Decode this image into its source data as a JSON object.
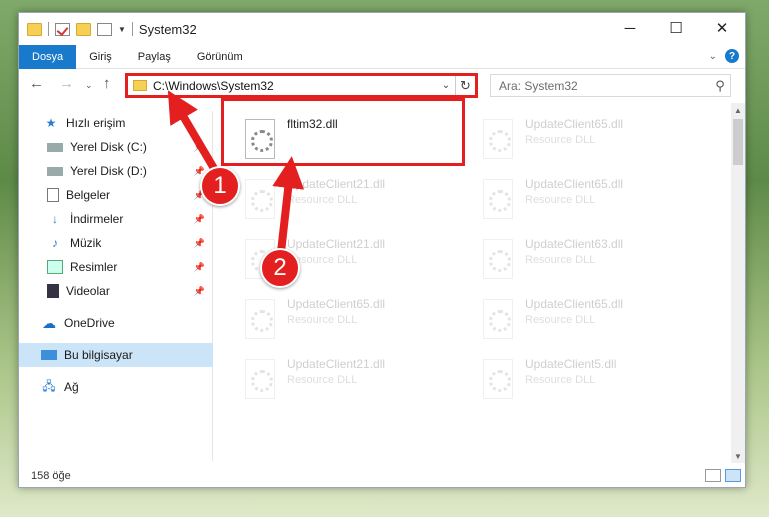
{
  "window": {
    "title": "System32",
    "controls": {
      "minimize": "─",
      "maximize": "☐",
      "close": "✕"
    }
  },
  "ribbon": {
    "tabs": [
      {
        "label": "Dosya",
        "active": true
      },
      {
        "label": "Giriş"
      },
      {
        "label": "Paylaş"
      },
      {
        "label": "Görünüm"
      }
    ],
    "help": "?"
  },
  "address": {
    "path": "C:\\Windows\\System32",
    "search_placeholder": "Ara: System32"
  },
  "nav": {
    "items": [
      {
        "label": "Hızlı erişim",
        "icon": "star-icon"
      },
      {
        "label": "Yerel Disk (C:)",
        "icon": "disk-icon",
        "pinned": true
      },
      {
        "label": "Yerel Disk (D:)",
        "icon": "disk-icon",
        "pinned": true
      },
      {
        "label": "Belgeler",
        "icon": "documents-icon",
        "pinned": true
      },
      {
        "label": "İndirmeler",
        "icon": "download-icon",
        "pinned": true
      },
      {
        "label": "Müzik",
        "icon": "music-icon",
        "pinned": true
      },
      {
        "label": "Resimler",
        "icon": "pictures-icon",
        "pinned": true
      },
      {
        "label": "Videolar",
        "icon": "videos-icon",
        "pinned": true
      },
      {
        "label": "OneDrive",
        "icon": "cloud-icon"
      },
      {
        "label": "Bu bilgisayar",
        "icon": "computer-icon",
        "selected": true
      },
      {
        "label": "Ağ",
        "icon": "network-icon"
      }
    ]
  },
  "files": {
    "highlighted": {
      "name": "fltim32.dll",
      "type": ""
    },
    "items": [
      {
        "name": "UpdateClient21.dll",
        "type": "Resource DLL"
      },
      {
        "name": "UpdateClient21.dll",
        "type": "Resource DLL"
      },
      {
        "name": "UpdateClient65.dll",
        "type": "Resource DLL"
      },
      {
        "name": "UpdateClient21.dll",
        "type": "Resource DLL"
      },
      {
        "name": "UpdateClient65.dll",
        "type": "Resource DLL"
      },
      {
        "name": "UpdateClient65.dll",
        "type": "Resource DLL"
      },
      {
        "name": "UpdateClient63.dll",
        "type": "Resource DLL"
      },
      {
        "name": "UpdateClient65.dll",
        "type": "Resource DLL"
      },
      {
        "name": "UpdateClient5.dll",
        "type": "Resource DLL"
      }
    ]
  },
  "status": {
    "count": "158 öğe"
  },
  "annotations": {
    "step1": "1",
    "step2": "2",
    "color": "#e31f1f"
  }
}
